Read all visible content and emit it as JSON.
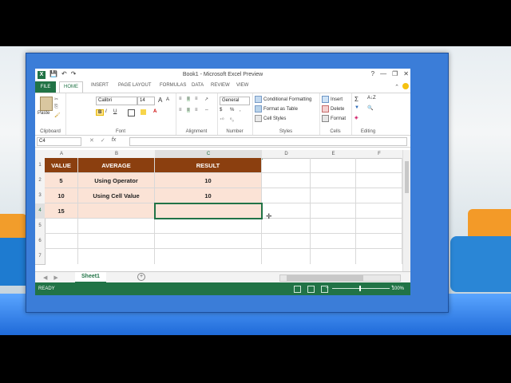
{
  "window": {
    "title": "Book1 - Microsoft Excel Preview"
  },
  "qat": {
    "save": "💾",
    "undo": "↶",
    "redo": "↷"
  },
  "controls": {
    "help": "?",
    "minimize": "—",
    "restore": "❐",
    "close": "✕"
  },
  "tabs": [
    "FILE",
    "HOME",
    "INSERT",
    "PAGE LAYOUT",
    "FORMULAS",
    "DATA",
    "REVIEW",
    "VIEW"
  ],
  "ribbon": {
    "clipboard": {
      "label": "Clipboard",
      "paste": "Paste"
    },
    "font": {
      "label": "Font",
      "family": "Calibri",
      "size": "14",
      "bold": "B",
      "italic": "I",
      "underline": "U",
      "grow": "A",
      "shrink": "A"
    },
    "alignment": {
      "label": "Alignment"
    },
    "number": {
      "label": "Number",
      "format": "General",
      "currency": "$",
      "percent": "%",
      "comma": ","
    },
    "styles": {
      "label": "Styles",
      "conditional": "Conditional Formatting",
      "table": "Format as Table",
      "cell": "Cell Styles"
    },
    "cells": {
      "label": "Cells",
      "insert": "Insert",
      "delete": "Delete",
      "format": "Format"
    },
    "editing": {
      "label": "Editing",
      "sum": "Σ",
      "sort": "A↓Z",
      "fill": "▼",
      "find": "🔍",
      "clear": "◈"
    }
  },
  "formula_bar": {
    "name_box": "C4",
    "fx": "fx",
    "cancel": "✕",
    "enter": "✓",
    "value": ""
  },
  "columns": [
    "A",
    "B",
    "C",
    "D",
    "E",
    "F"
  ],
  "rows": [
    "1",
    "2",
    "3",
    "4",
    "5",
    "6",
    "7"
  ],
  "table": {
    "headers": [
      "VALUE",
      "AVERAGE",
      "RESULT"
    ],
    "data": [
      [
        "5",
        "Using Operator",
        "10"
      ],
      [
        "10",
        "Using Cell Value",
        "10"
      ],
      [
        "15",
        "",
        ""
      ]
    ]
  },
  "sheet": {
    "tab": "Sheet1",
    "add": "+"
  },
  "status": {
    "ready": "READY",
    "zoom": "100%",
    "zoom_minus": "–",
    "zoom_plus": "+"
  }
}
